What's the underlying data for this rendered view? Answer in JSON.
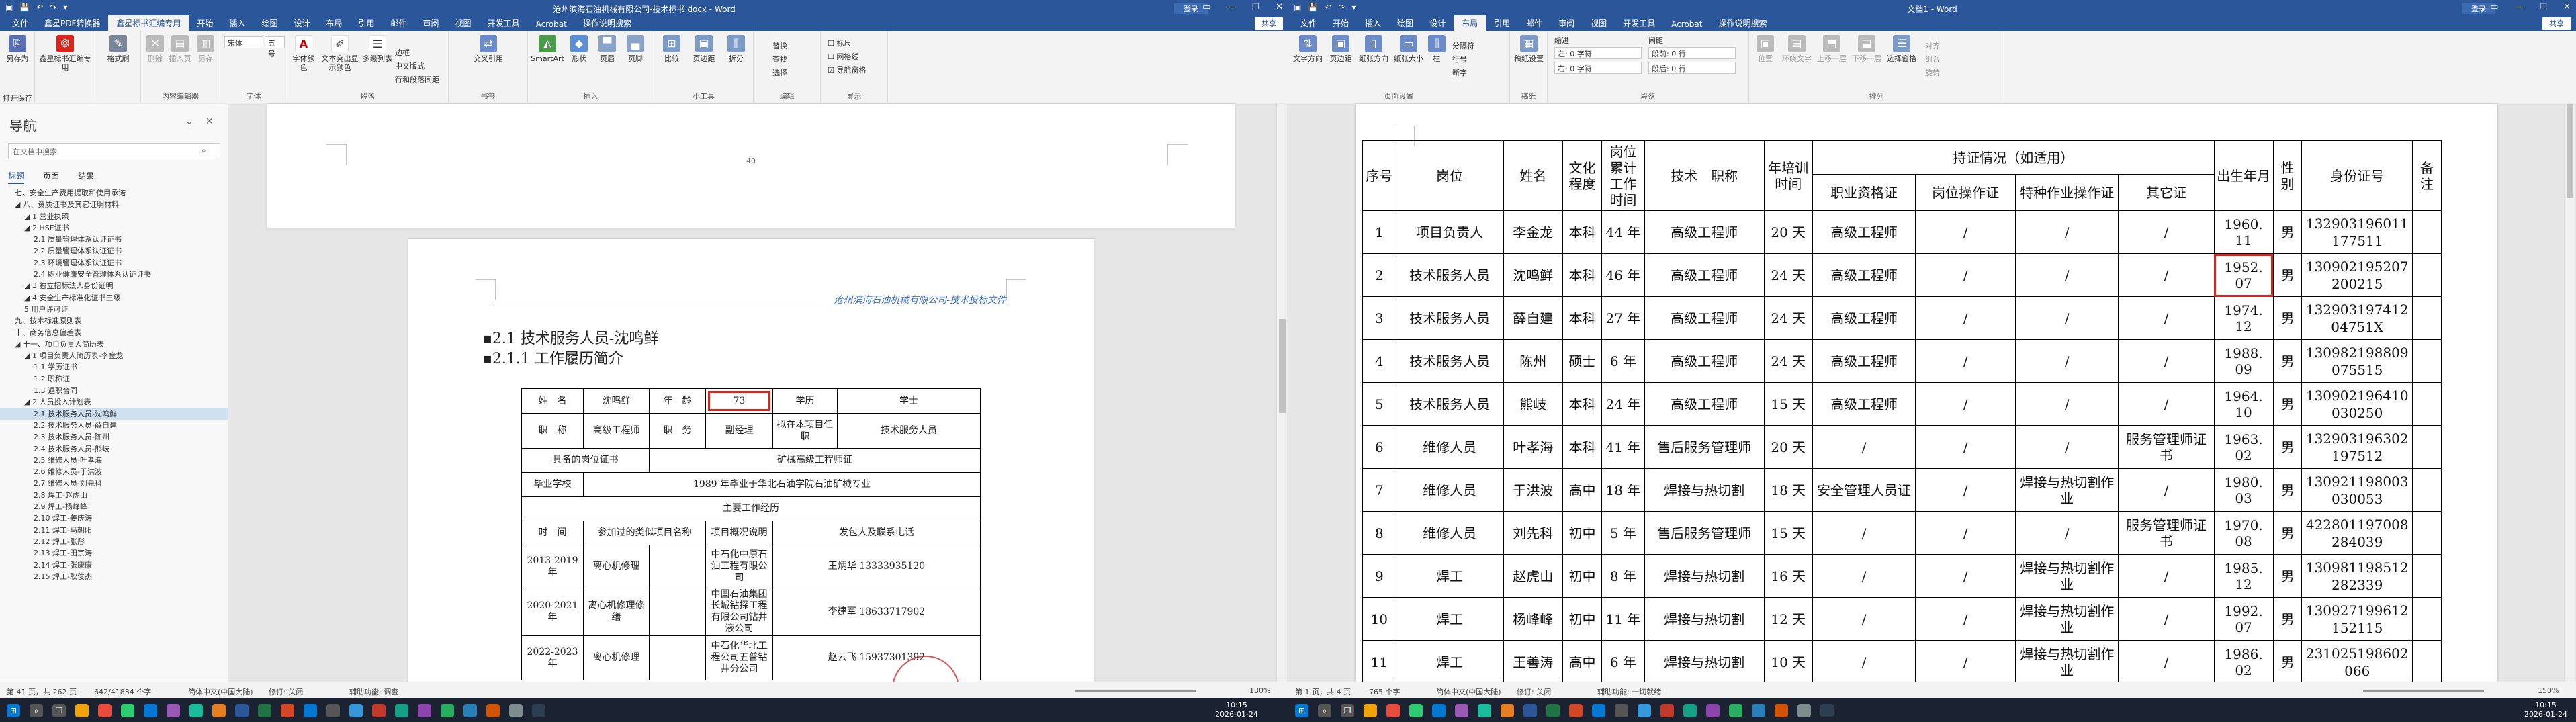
{
  "left_window": {
    "title": "沧州滨海石油机械有限公司-技术标书.docx - Word",
    "account": "登录",
    "share": "共享",
    "tabs": [
      "文件",
      "鑫星PDF转换器",
      "鑫星标书汇编专用",
      "开始",
      "插入",
      "绘图",
      "设计",
      "布局",
      "引用",
      "邮件",
      "审阅",
      "视图",
      "开发工具",
      "Acrobat",
      "操作说明搜索"
    ],
    "active_tab": "鑫星标书汇编专用",
    "ribbon": {
      "g1_buttons": [
        "另存为",
        "打开保存"
      ],
      "g2_buttons": [
        "鑫星标书汇编专用"
      ],
      "g2b_buttons": [
        "格式刷"
      ],
      "g3_buttons": [
        "删除",
        "插入页",
        "另存"
      ],
      "g3_label": "内容编辑器",
      "font_name": "宋体",
      "font_size": "五号",
      "font_label": "字体",
      "g4_buttons": [
        "字体颜色",
        "文本突出显示颜色",
        "多级列表"
      ],
      "g4_small": [
        "边框",
        "中文版式",
        "行和段落间距"
      ],
      "g4_label": "段落",
      "g5_buttons": [
        "交叉引用"
      ],
      "g5_label": "书签",
      "g6_buttons": [
        "SmartArt",
        "形状",
        "页眉",
        "页脚"
      ],
      "g6_label": "插入",
      "g7_buttons": [
        "比较",
        "页边距",
        "拆分"
      ],
      "g7_label": "小工具",
      "g8_small": [
        "替换",
        "查找",
        "选择"
      ],
      "g8_label": "编辑",
      "g9_checks": [
        "标尺",
        "网格线",
        "导航窗格"
      ],
      "g9_label": "显示"
    },
    "nav": {
      "header": "导航",
      "search_placeholder": "在文档中搜索",
      "tabs": [
        "标题",
        "页面",
        "结果"
      ],
      "items": [
        "七、安全生产费用提取和使用承诺",
        "八、资质证书及其它证明材料",
        "1 营业执照",
        "2 HSE证书",
        "2.1 质量管理体系认证证书",
        "2.2 质量管理体系认证证书",
        "2.3 环境管理体系认证证书",
        "2.4 职业健康安全管理体系认证证书",
        "3 独立招标法人身份证明",
        "4 安全生产标准化证书三级",
        "5 用户许可证",
        "九、技术标准原则表",
        "十、商务信息偏差表",
        "十一、项目负责人简历表",
        "1 项目负责人简历表-李金龙",
        "1.1 学历证书",
        "1.2 职称证",
        "1.3 退职合同",
        "2 人员投入计划表",
        "2.1 技术服务人员-沈鸣鲜",
        "2.2 技术服务人员-薛自建",
        "2.3 技术服务人员-陈州",
        "2.4 技术服务人员-熊岐",
        "2.5 维修人员-叶孝海",
        "2.6 维修人员-于洪波",
        "2.7 维修人员-刘先科",
        "2.8 焊工-赵虎山",
        "2.9 焊工-杨峰峰",
        "2.10 焊工-姜庆涛",
        "2.11 焊工-马朝阳",
        "2.12 焊工-张彤",
        "2.13 焊工-田宗涛",
        "2.14 焊工-张康康",
        "2.15 焊工-耿俊杰"
      ],
      "selected_index": 19
    },
    "doc": {
      "page_number": "40",
      "header_text": "沧州滨海石油机械有限公司-技术投标文件",
      "heading1": "2.1 技术服务人员-沈鸣鲜",
      "heading2": "2.1.1 工作履历简介",
      "resume": {
        "name_label": "姓　名",
        "name": "沈鸣鲜",
        "age_label": "年　龄",
        "age": "73",
        "edu_label": "学历",
        "edu": "学士",
        "title_label": "职　称",
        "title": "高级工程师",
        "post_label": "职　务",
        "post": "副经理",
        "role_label": "拟在本项目任职",
        "role": "技术服务人员",
        "cert_label": "具备的岗位证书",
        "cert": "矿械高级工程师证",
        "school_label": "毕业学校",
        "school": "1989 年毕业于华北石油学院石油矿械专业",
        "exp_label": "主要工作经历",
        "col_time": "时　间",
        "col_project": "参加过的类似项目名称",
        "col_desc": "项目概况说明",
        "col_contact": "发包人及联系电话",
        "rows": [
          {
            "time": "2013-2019 年",
            "project": "离心机修理",
            "desc": "中石化中原石油工程有限公司",
            "contact": "王炳华 13333935120"
          },
          {
            "time": "2020-2021 年",
            "project": "离心机修理修缮",
            "desc": "中国石油集团长城钻探工程有限公司钻井液公司",
            "contact": "李建军 18633717902"
          },
          {
            "time": "2022-2023 年",
            "project": "离心机修理",
            "desc": "中石化华北工程公司五普钻井分公司",
            "contact": "赵云飞 15937301392"
          }
        ]
      }
    },
    "status": {
      "page": "第 41 页，共 262 页",
      "words": "642/41834 个字",
      "lang": "简体中文(中国大陆)",
      "track": "修订: 关闭",
      "access": "辅助功能: 调查",
      "zoom": "130%"
    }
  },
  "right_window": {
    "title": "文档1 - Word",
    "account": "登录",
    "share": "共享",
    "tabs": [
      "文件",
      "开始",
      "插入",
      "绘图",
      "设计",
      "布局",
      "引用",
      "邮件",
      "审阅",
      "视图",
      "开发工具",
      "Acrobat",
      "操作说明搜索"
    ],
    "active_tab": "布局",
    "ribbon": {
      "g1_buttons": [
        "文字方向",
        "页边距",
        "纸张方向",
        "纸张大小",
        "栏"
      ],
      "g1_small": [
        "分隔符",
        "行号",
        "断字"
      ],
      "g1_label": "页面设置",
      "g2_buttons": [
        "稿纸设置"
      ],
      "g2_label": "稿纸",
      "indent_label": "缩进",
      "spacing_label": "间距",
      "indent_left": "左: 0 字符",
      "indent_right": "右: 0 字符",
      "space_before": "段前: 0 行",
      "space_after": "段后: 0 行",
      "para_label": "段落",
      "g4_buttons": [
        "位置",
        "环绕文字",
        "上移一层",
        "下移一层",
        "选择窗格"
      ],
      "g4_small": [
        "对齐",
        "组合",
        "旋转"
      ],
      "g4_label": "排列"
    },
    "table": {
      "header_top": [
        "序号",
        "岗位",
        "姓名",
        "文化程度",
        "岗位累计工作时间",
        "技术　职称",
        "年培训时间",
        "持证情况（如适用）",
        "出生年月",
        "性别",
        "身份证号",
        "备注"
      ],
      "header_sub": [
        "职业资格证",
        "岗位操作证",
        "特种作业操作证",
        "其它证"
      ],
      "rows": [
        [
          "1",
          "项目负责人",
          "李金龙",
          "本科",
          "44 年",
          "高级工程师",
          "20 天",
          "高级工程师",
          "/",
          "/",
          "/",
          "1960. 11",
          "男",
          "132903196011177511",
          ""
        ],
        [
          "2",
          "技术服务人员",
          "沈鸣鲜",
          "本科",
          "46 年",
          "高级工程师",
          "24 天",
          "高级工程师",
          "/",
          "/",
          "/",
          "1952. 07",
          "男",
          "130902195207200215",
          ""
        ],
        [
          "3",
          "技术服务人员",
          "薛自建",
          "本科",
          "27 年",
          "高级工程师",
          "24 天",
          "高级工程师",
          "/",
          "/",
          "/",
          "1974. 12",
          "男",
          "13290319741204751X",
          ""
        ],
        [
          "4",
          "技术服务人员",
          "陈州",
          "硕士",
          "6 年",
          "高级工程师",
          "24 天",
          "高级工程师",
          "/",
          "/",
          "/",
          "1988. 09",
          "男",
          "130982198809075515",
          ""
        ],
        [
          "5",
          "技术服务人员",
          "熊岐",
          "本科",
          "24 年",
          "高级工程师",
          "15 天",
          "高级工程师",
          "/",
          "/",
          "/",
          "1964. 10",
          "男",
          "130902196410030250",
          ""
        ],
        [
          "6",
          "维修人员",
          "叶孝海",
          "本科",
          "41 年",
          "售后服务管理师",
          "20 天",
          "/",
          "/",
          "/",
          "服务管理师证书",
          "1963. 02",
          "男",
          "132903196302197512",
          ""
        ],
        [
          "7",
          "维修人员",
          "于洪波",
          "高中",
          "18 年",
          "焊接与热切割",
          "18 天",
          "安全管理人员证",
          "/",
          "焊接与热切割作业",
          "/",
          "1980. 03",
          "男",
          "130921198003030053",
          ""
        ],
        [
          "8",
          "维修人员",
          "刘先科",
          "初中",
          "5 年",
          "售后服务管理师",
          "15 天",
          "/",
          "/",
          "/",
          "服务管理师证书",
          "1970. 08",
          "男",
          "422801197008284039",
          ""
        ],
        [
          "9",
          "焊工",
          "赵虎山",
          "初中",
          "8 年",
          "焊接与热切割",
          "16 天",
          "/",
          "/",
          "焊接与热切割作业",
          "/",
          "1985. 12",
          "男",
          "130981198512282339",
          ""
        ],
        [
          "10",
          "焊工",
          "杨峰峰",
          "初中",
          "11 年",
          "焊接与热切割",
          "12 天",
          "/",
          "/",
          "焊接与热切割作业",
          "/",
          "1992. 07",
          "男",
          "130927199612152115",
          ""
        ],
        [
          "11",
          "焊工",
          "王善涛",
          "高中",
          "6 年",
          "焊接与热切割",
          "10 天",
          "/",
          "/",
          "焊接与热切割作业",
          "/",
          "1986. 02",
          "男",
          "231025198602066",
          ""
        ]
      ]
    },
    "status": {
      "page": "第 1 页，共 4 页",
      "words": "765 个字",
      "lang": "简体中文(中国大陆)",
      "track": "修订: 关闭",
      "access": "辅助功能: 一切就绪",
      "zoom": "150%"
    }
  },
  "taskbar": {
    "left_clock_time": "10:15",
    "left_clock_date": "2026-01-24",
    "right_clock_time": "10:15",
    "right_clock_date": "2026-01-24",
    "icons": [
      "start-icon",
      "search-icon",
      "task-view-icon",
      "app-icon-1",
      "app-icon-2",
      "app-icon-3",
      "app-icon-4",
      "app-icon-5",
      "app-icon-6",
      "app-icon-7",
      "app-icon-8",
      "app-icon-9",
      "app-icon-10",
      "app-icon-11",
      "app-icon-12",
      "app-icon-13",
      "app-icon-14",
      "app-icon-15",
      "app-icon-16",
      "app-icon-17",
      "app-icon-18",
      "app-icon-19",
      "app-icon-20",
      "app-icon-21"
    ]
  },
  "colors": {
    "word_blue": "#2b579a",
    "highlight_red": "#d9261c",
    "selected_nav": "#cfe0f3",
    "header_text_blue": "#3b6fc9"
  }
}
